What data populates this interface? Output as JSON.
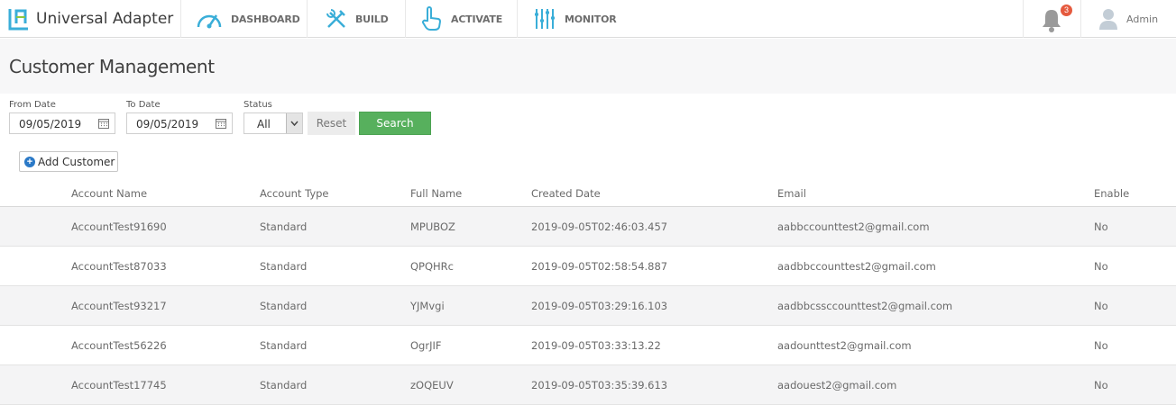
{
  "app": {
    "title": "Universal Adapter"
  },
  "nav": {
    "items": [
      {
        "label": "DASHBOARD",
        "icon": "speedometer-icon"
      },
      {
        "label": "BUILD",
        "icon": "tools-icon"
      },
      {
        "label": "ACTIVATE",
        "icon": "hand-pointer-icon"
      },
      {
        "label": "MONITOR",
        "icon": "sliders-icon"
      }
    ],
    "notifications_count": "3",
    "user_label": "Admin"
  },
  "page": {
    "title": "Customer Management"
  },
  "filters": {
    "from_label": "From Date",
    "from_value": "09/05/2019",
    "to_label": "To Date",
    "to_value": "09/05/2019",
    "status_label": "Status",
    "status_value": "All",
    "reset_label": "Reset",
    "search_label": "Search"
  },
  "actions": {
    "add_customer_label": "Add Customer"
  },
  "colors": {
    "accent_teal": "#3aaed8",
    "search_green": "#57b05d",
    "badge_red": "#e55a3e"
  },
  "table": {
    "columns": [
      "Account Name",
      "Account Type",
      "Full Name",
      "Created Date",
      "Email",
      "Enable"
    ],
    "rows": [
      [
        "AccountTest91690",
        "Standard",
        "MPUBOZ",
        "2019-09-05T02:46:03.457",
        "aabbccounttest2@gmail.com",
        "No"
      ],
      [
        "AccountTest87033",
        "Standard",
        "QPQHRc",
        "2019-09-05T02:58:54.887",
        "aadbbccounttest2@gmail.com",
        "No"
      ],
      [
        "AccountTest93217",
        "Standard",
        "YJMvgi",
        "2019-09-05T03:29:16.103",
        "aadbbcssccounttest2@gmail.com",
        "No"
      ],
      [
        "AccountTest56226",
        "Standard",
        "OgrJIF",
        "2019-09-05T03:33:13.22",
        "aadounttest2@gmail.com",
        "No"
      ],
      [
        "AccountTest17745",
        "Standard",
        "zOQEUV",
        "2019-09-05T03:35:39.613",
        "aadouest2@gmail.com",
        "No"
      ]
    ]
  }
}
